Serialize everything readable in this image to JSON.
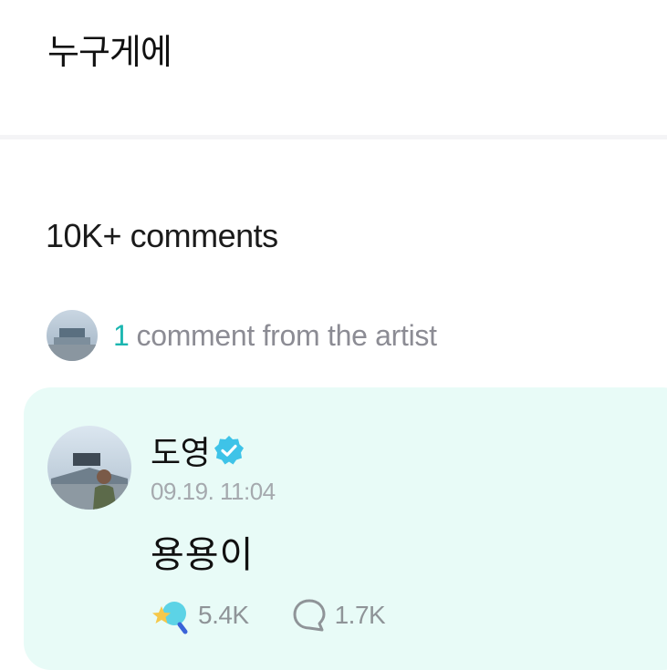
{
  "post": {
    "text": "누구게에"
  },
  "comments_header": {
    "count_label": "10K+ comments"
  },
  "artist_summary": {
    "count": "1",
    "label": "comment from the artist"
  },
  "artist_comment": {
    "author": "도영",
    "timestamp": "09.19. 11:04",
    "text": "용용이",
    "likes": "5.4K",
    "replies": "1.7K",
    "verified_icon": "verified-badge-icon",
    "like_icon": "star-heart-reaction-icon",
    "reply_icon": "speech-bubble-icon"
  },
  "colors": {
    "accent": "#1bb6b0",
    "card_bg": "#e8fbf7",
    "muted_text": "#8c8c94",
    "verified": "#3ec3e8"
  }
}
